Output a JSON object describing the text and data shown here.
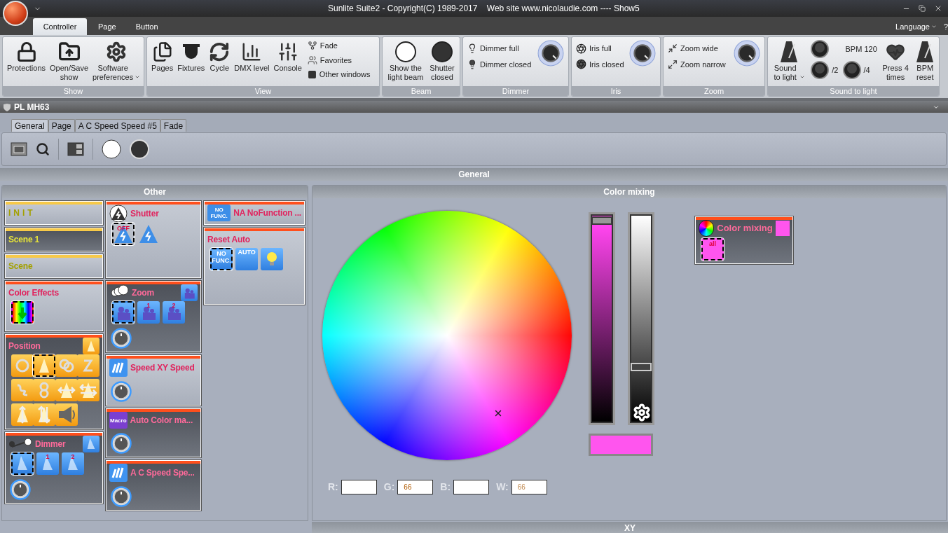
{
  "window": {
    "title": "Sunlite Suite2 - Copyright(C) 1989-2017    Web site www.nicolaudie.com ---- Show5"
  },
  "ribbon": {
    "tabs": [
      {
        "label": "Controller",
        "selected": true
      },
      {
        "label": "Page",
        "selected": false
      },
      {
        "label": "Button",
        "selected": false
      }
    ],
    "language": "Language",
    "help": "?",
    "groups": [
      {
        "title": "Show",
        "kind": "buttons",
        "large": [
          {
            "label": "Protections"
          },
          {
            "label": "Open/Save show"
          },
          {
            "label": "Software preferences",
            "dropdown": true
          }
        ]
      },
      {
        "title": "View",
        "kind": "buttons",
        "large": [
          {
            "label": "Pages"
          },
          {
            "label": "Fixtures"
          },
          {
            "label": "Cycle"
          },
          {
            "label": "DMX level"
          },
          {
            "label": "Console"
          }
        ],
        "small": [
          {
            "label": "Fade"
          },
          {
            "label": "Favorites"
          },
          {
            "label": "Other windows"
          }
        ]
      },
      {
        "title": "Beam",
        "kind": "buttons",
        "large": [
          {
            "label": "Show the light beam"
          },
          {
            "label": "Shutter closed"
          }
        ]
      },
      {
        "title": "Dimmer",
        "kind": "knob",
        "small": [
          {
            "label": "Dimmer full"
          },
          {
            "label": "Dimmer closed"
          }
        ]
      },
      {
        "title": "Iris",
        "kind": "knob",
        "small": [
          {
            "label": "Iris full"
          },
          {
            "label": "Iris closed"
          }
        ]
      },
      {
        "title": "Zoom",
        "kind": "knob",
        "small": [
          {
            "label": "Zoom wide"
          },
          {
            "label": "Zoom narrow"
          }
        ]
      },
      {
        "title": "Sound to light",
        "kind": "sound",
        "large": [
          {
            "label": "Sound to light",
            "dropdown": true
          }
        ],
        "bpm": "BPM 120",
        "pads": [
          {
            "label": "/2"
          },
          {
            "label": "/4"
          }
        ],
        "extra": [
          {
            "label": "Press 4 times"
          },
          {
            "label": "BPM reset"
          }
        ]
      }
    ]
  },
  "panel": {
    "title": "PL MH63",
    "tabs": [
      {
        "label": "General",
        "selected": true
      },
      {
        "label": "Page",
        "selected": false
      },
      {
        "label": "A C Speed Speed #5",
        "selected": false
      },
      {
        "label": "Fade",
        "selected": false
      }
    ],
    "section": "General",
    "other": {
      "title": "Other",
      "columns": [
        [
          {
            "kind": "scene",
            "title": "INIT",
            "active": false
          },
          {
            "kind": "scene",
            "title": "Scene 1",
            "active": true
          },
          {
            "kind": "scene",
            "title": "Scene",
            "active": false
          },
          {
            "kind": "colorfx",
            "title": "Color Effects",
            "active": false,
            "buttons": [
              {
                "kind": "colorfx",
                "selected": true
              }
            ]
          },
          {
            "kind": "position",
            "title": "Position",
            "active": true,
            "corner": {
              "kind": "spot",
              "selected": false
            },
            "buttons": [
              {
                "kind": "circle",
                "selected": false
              },
              {
                "kind": "spot",
                "selected": true
              },
              {
                "kind": "rings",
                "selected": false
              },
              {
                "kind": "curve",
                "selected": false
              },
              {
                "kind": "squiggle",
                "selected": false
              },
              {
                "kind": "eight",
                "selected": false
              },
              {
                "kind": "pan",
                "selected": false
              },
              {
                "kind": "pan2",
                "selected": false
              },
              {
                "kind": "tilt",
                "selected": false
              },
              {
                "kind": "tilt2",
                "selected": false
              },
              {
                "kind": "speaker",
                "selected": false
              }
            ]
          },
          {
            "kind": "dimmer",
            "title": "Dimmer",
            "active": true,
            "corner": {
              "kind": "beam",
              "selected": false
            },
            "knob": true,
            "buttons": [
              {
                "kind": "beam",
                "selected": true
              },
              {
                "kind": "beam",
                "selected": false,
                "label": "1"
              },
              {
                "kind": "beam",
                "selected": false,
                "label": "2"
              }
            ]
          }
        ],
        [
          {
            "kind": "shutter",
            "title": "Shutter",
            "active": false,
            "buttons": [
              {
                "kind": "strobe",
                "selected": true,
                "label": "OFF"
              },
              {
                "kind": "strobe",
                "selected": false
              }
            ]
          },
          {
            "kind": "zoom",
            "title": "Zoom",
            "active": true,
            "corner": {
              "kind": "zoom",
              "selected": false
            },
            "knob": true,
            "buttons": [
              {
                "kind": "zoom",
                "selected": true
              },
              {
                "kind": "zoom",
                "selected": false,
                "label": "1"
              },
              {
                "kind": "zoom",
                "selected": false,
                "label": "2"
              }
            ]
          },
          {
            "kind": "speed",
            "title": "Speed XY Speed",
            "active": false,
            "knob": true
          },
          {
            "kind": "macro",
            "title": "Auto Color ma...",
            "badge": "Macro",
            "active": true,
            "knob": true
          },
          {
            "kind": "speed",
            "title": "A C Speed Spe...",
            "active": true,
            "knob": true
          }
        ],
        [
          {
            "kind": "nofunc",
            "title": "NA NoFunction ...",
            "badge": "NO FUNC.",
            "active": false
          },
          {
            "kind": "reset",
            "title": "Reset Auto",
            "active": false,
            "buttons": [
              {
                "kind": "nofunc",
                "selected": true,
                "label": "NO FUNC."
              },
              {
                "kind": "auto",
                "selected": false,
                "label": "AUTO"
              },
              {
                "kind": "bulb",
                "selected": false
              }
            ]
          }
        ]
      ]
    },
    "color_mixing": {
      "title": "Color mixing",
      "sliders": [
        {
          "kind": "hue",
          "level": 0.99,
          "color": "#ff44ee"
        },
        {
          "kind": "brightness",
          "level": 0.26
        }
      ],
      "preview": {
        "color": "#ff55ee"
      },
      "fields": [
        {
          "label": "R:"
        },
        {
          "label": "G:",
          "value": "66",
          "disabled": false
        },
        {
          "label": "B:"
        },
        {
          "label": "W:",
          "value": "66",
          "disabled": true
        }
      ],
      "card": {
        "title": "Color mixing",
        "active": true,
        "swatch": {
          "color": "#ff55ee"
        },
        "buttons": [
          {
            "kind": "color",
            "selected": true,
            "label": "all",
            "color": "#ff55ee"
          }
        ]
      }
    },
    "bottom": {
      "title": "XY"
    }
  }
}
